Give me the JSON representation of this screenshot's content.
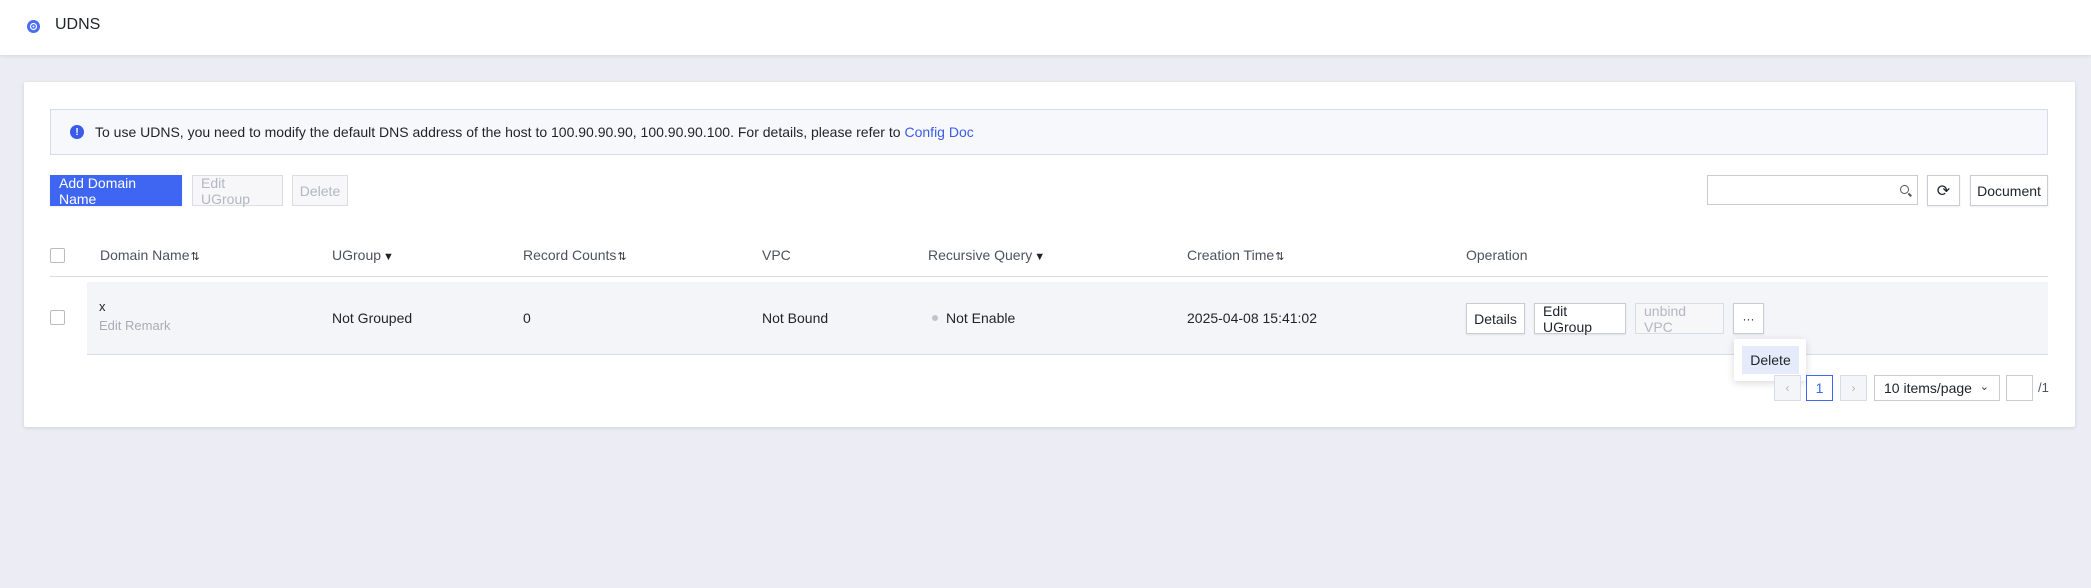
{
  "app": {
    "title": "UDNS",
    "logo_icon": "udns-logo-icon"
  },
  "notice": {
    "text": "To use UDNS, you need to modify the default DNS address of the host to 100.90.90.90, 100.90.90.100. For details, please refer to",
    "link": "Config Doc",
    "icon_glyph": "!"
  },
  "toolbar": {
    "add_label": "Add Domain Name",
    "edit_ugroup_label": "Edit UGroup",
    "delete_label": "Delete",
    "search_placeholder": "",
    "refresh_glyph": "⟳",
    "document_label": "Document"
  },
  "table": {
    "columns": {
      "domain_name": "Domain Name",
      "ugroup": "UGroup",
      "record_counts": "Record Counts",
      "vpc": "VPC",
      "recursive_query": "Recursive Query",
      "creation_time": "Creation Time",
      "operation": "Operation"
    },
    "sort_glyph": "⇅",
    "filter_glyph": "▼",
    "rows": [
      {
        "domain": "x",
        "remark": "Edit Remark",
        "ugroup": "Not Grouped",
        "record_counts": "0",
        "vpc": "Not Bound",
        "recursive_query": "Not Enable",
        "creation_time": "2025-04-08 15:41:02",
        "actions": {
          "details": "Details",
          "edit_ugroup": "Edit UGroup",
          "unbind_vpc": "unbind VPC",
          "more": "···"
        }
      }
    ]
  },
  "dropdown": {
    "delete": "Delete"
  },
  "pagination": {
    "prev": "‹",
    "next": "›",
    "current_page": "1",
    "page_size": "10 items/page",
    "page_size_chevron": "⌄",
    "total_pages": "/1"
  },
  "colors": {
    "accent": "#3e66f3",
    "background": "#ecedf4",
    "link": "#3a5ce9"
  }
}
